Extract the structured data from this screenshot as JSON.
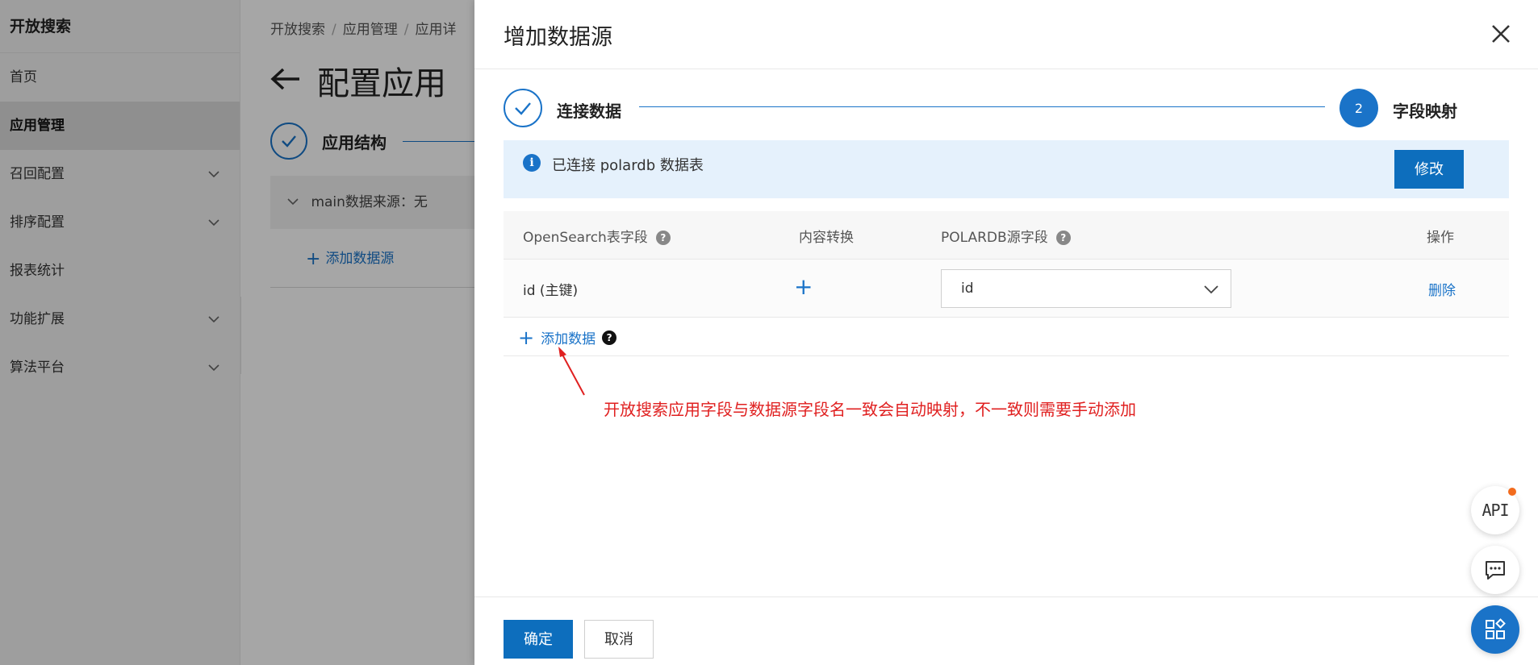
{
  "background": {
    "brand": "开放搜索",
    "sidebar_items": [
      {
        "label": "首页",
        "has_chevron": false
      },
      {
        "label": "应用管理",
        "has_chevron": false,
        "active": true
      },
      {
        "label": "召回配置",
        "has_chevron": true
      },
      {
        "label": "排序配置",
        "has_chevron": true
      },
      {
        "label": "报表统计",
        "has_chevron": false
      },
      {
        "label": "功能扩展",
        "has_chevron": true
      },
      {
        "label": "算法平台",
        "has_chevron": true
      }
    ],
    "breadcrumb": [
      "开放搜索",
      "应用管理",
      "应用详"
    ],
    "page_title": "配置应用",
    "step_label": "应用结构",
    "datasource_label": "main数据来源：无",
    "add_datasource": "添加数据源"
  },
  "drawer": {
    "title": "增加数据源",
    "steps": [
      {
        "number": "1",
        "label": "连接数据",
        "status": "done"
      },
      {
        "number": "2",
        "label": "字段映射",
        "status": "active"
      }
    ],
    "info_text": "已连接 polardb 数据表",
    "modify_button": "修改",
    "table": {
      "headers": [
        "OpenSearch表字段",
        "内容转换",
        "POLARDB源字段",
        "操作"
      ],
      "rows": [
        {
          "field": "id (主键)",
          "source_field": "id",
          "action": "删除"
        }
      ]
    },
    "add_data_label": "添加数据",
    "annotation": "开放搜索应用字段与数据源字段名一致会自动映射，不一致则需要手动添加",
    "ok_button": "确定",
    "cancel_button": "取消"
  },
  "floating": {
    "api_label": "API"
  },
  "colors": {
    "primary": "#1a73c8",
    "button": "#0d6ebd",
    "annotation": "#e02020",
    "info_bg": "#e5f1fc",
    "badge": "#f26b1d"
  }
}
